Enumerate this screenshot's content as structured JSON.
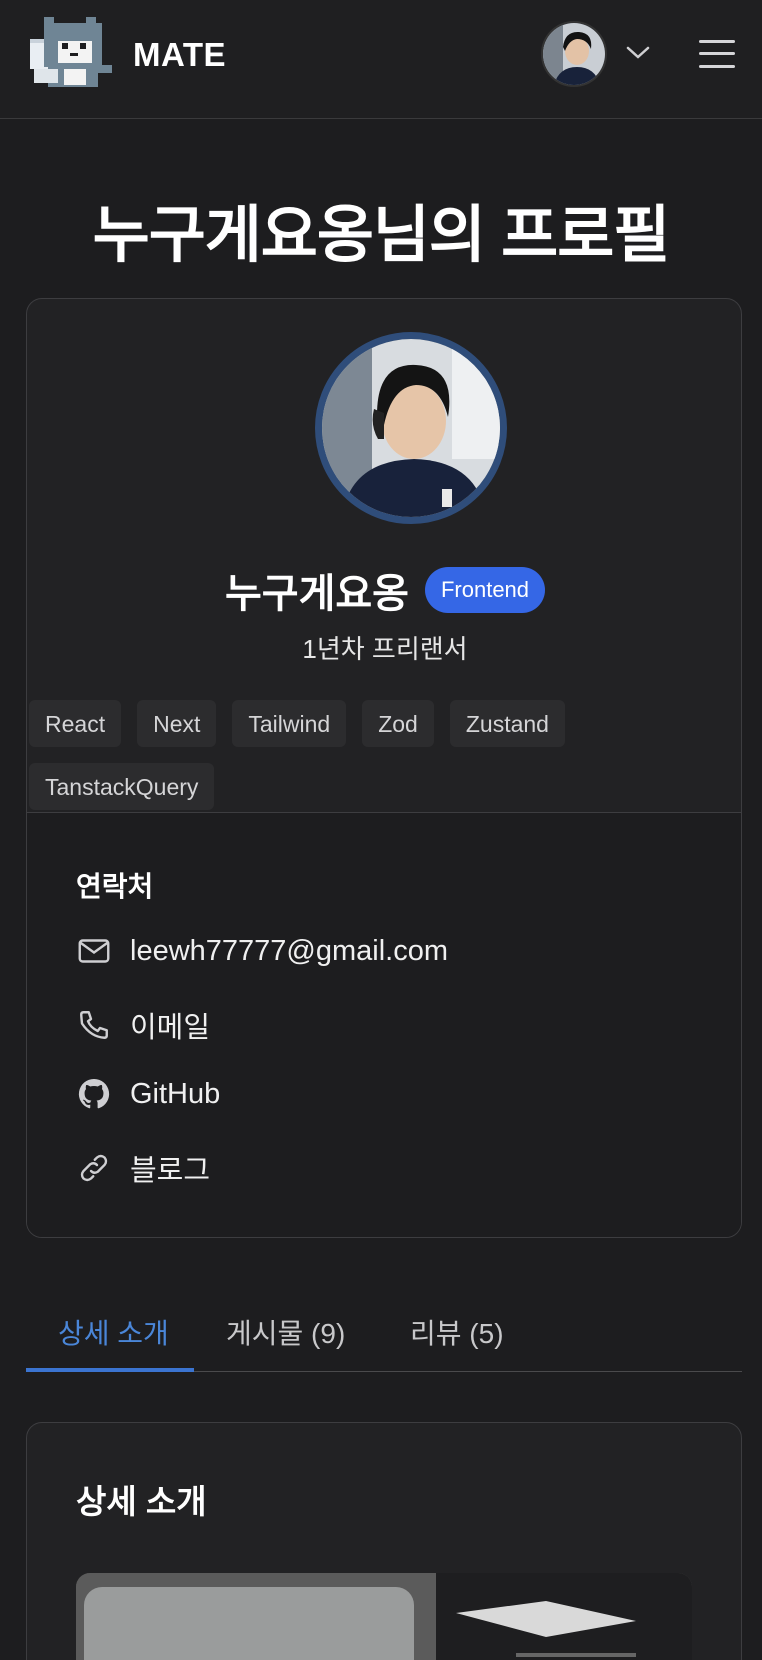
{
  "header": {
    "brand": "MATE",
    "icons": [
      "cat-logo",
      "avatar",
      "chevron-down-icon",
      "hamburger-menu-icon"
    ]
  },
  "page": {
    "title": "누구게요옹님의 프로필"
  },
  "profile": {
    "name": "누구게요옹",
    "role_badge": "Frontend",
    "subtitle": "1년차 프리랜서",
    "tags": [
      "React",
      "Next",
      "Tailwind",
      "Zod",
      "Zustand",
      "TanstackQuery"
    ]
  },
  "contact": {
    "title": "연락처",
    "email": "leewh77777@gmail.com",
    "phone": "이메일",
    "github": "GitHub",
    "blog": "블로그"
  },
  "tabs": [
    {
      "label": "상세 소개",
      "active": true
    },
    {
      "label": "게시물 (9)",
      "active": false
    },
    {
      "label": "리뷰 (5)",
      "active": false
    }
  ],
  "detail": {
    "title": "상세 소개"
  },
  "colors": {
    "accent": "#3567e6",
    "tab_active": "#4a86d8",
    "background": "#1d1d1f"
  }
}
